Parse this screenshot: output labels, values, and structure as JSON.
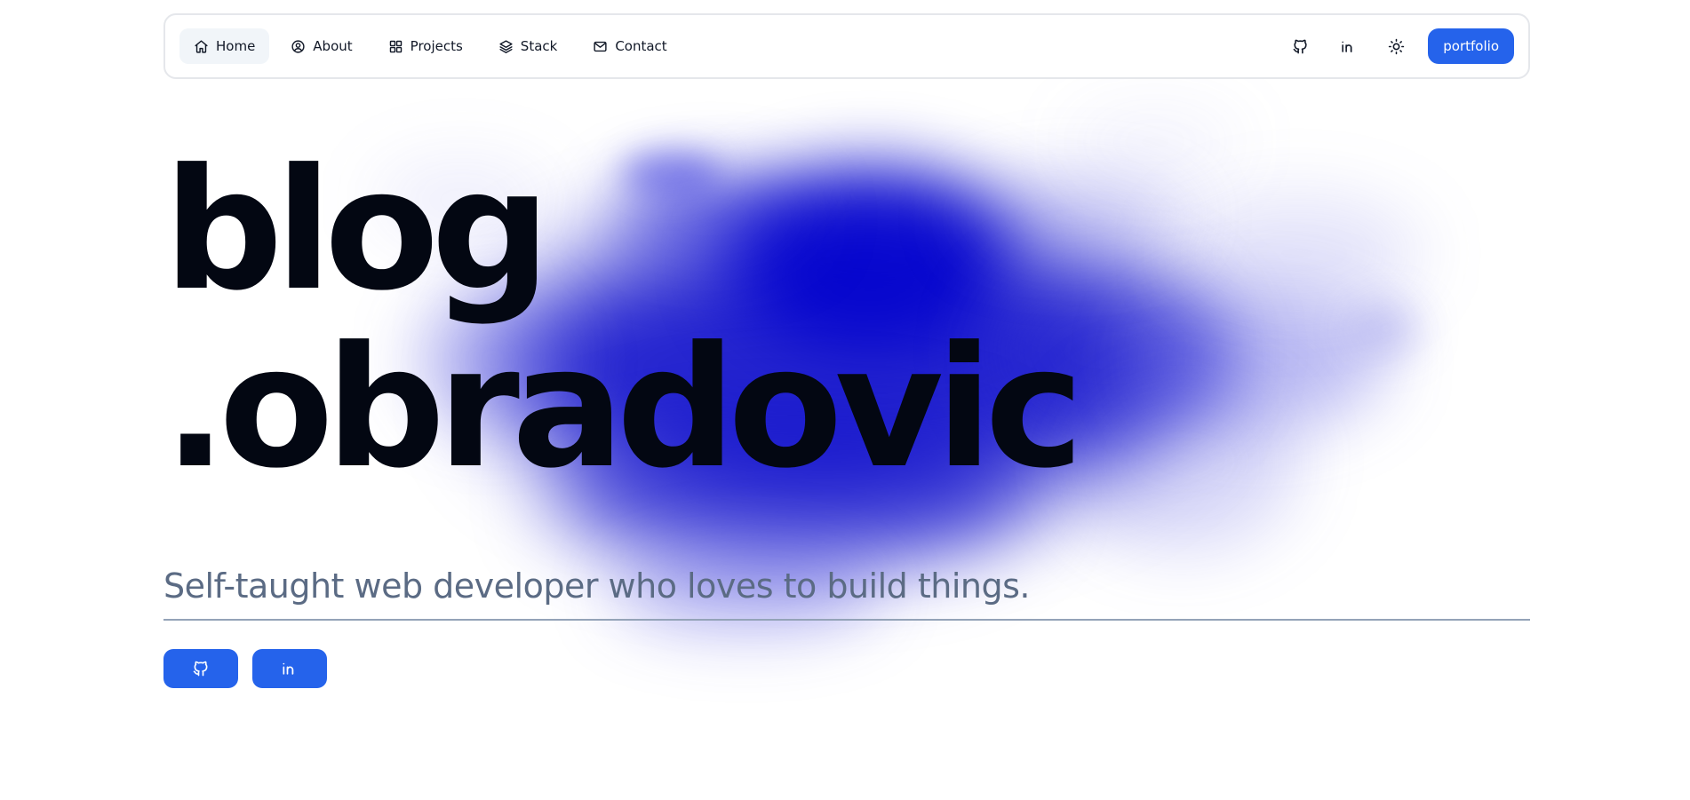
{
  "nav": {
    "items": [
      {
        "label": "Home",
        "icon": "home-icon",
        "active": true
      },
      {
        "label": "About",
        "icon": "user-circle-icon",
        "active": false
      },
      {
        "label": "Projects",
        "icon": "grid-icon",
        "active": false
      },
      {
        "label": "Stack",
        "icon": "layers-icon",
        "active": false
      },
      {
        "label": "Contact",
        "icon": "mail-icon",
        "active": false
      }
    ],
    "right_icons": [
      "github-icon",
      "linkedin-icon",
      "sun-icon"
    ],
    "portfolio_label": "portfolio"
  },
  "hero": {
    "title_line1": "blog",
    "title_line2": ".obradovic",
    "tagline": "Self-taught web developer who loves to build things."
  },
  "social_buttons": [
    "github-icon",
    "linkedin-icon"
  ],
  "colors": {
    "accent": "#2563eb",
    "title": "#030712",
    "tagline": "#5b6b84",
    "blob": "#0000c8"
  }
}
